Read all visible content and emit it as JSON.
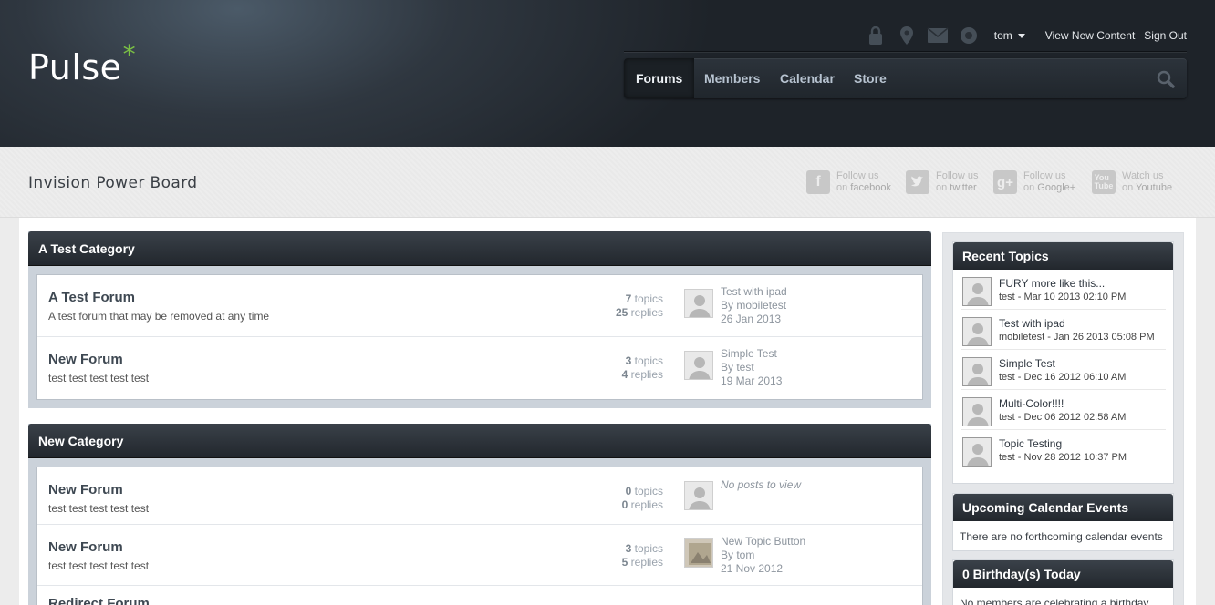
{
  "header": {
    "logo_text": "Pulse",
    "logo_mark": "*",
    "user": "tom",
    "view_new_content": "View New Content",
    "sign_out": "Sign Out"
  },
  "nav": {
    "tabs": [
      "Forums",
      "Members",
      "Calendar",
      "Store"
    ]
  },
  "board_title": "Invision Power Board",
  "social": [
    {
      "icon": "facebook-icon",
      "line1": "Follow us",
      "line2_prefix": "on ",
      "line2": "facebook"
    },
    {
      "icon": "twitter-icon",
      "line1": "Follow us",
      "line2_prefix": "on ",
      "line2": "twitter"
    },
    {
      "icon": "google-plus-icon",
      "line1": "Follow us",
      "line2_prefix": "on ",
      "line2": "Google+"
    },
    {
      "icon": "youtube-icon",
      "line1": "Watch us",
      "line2_prefix": "on ",
      "line2": "Youtube"
    }
  ],
  "categories": [
    {
      "title": "A Test Category",
      "forums": [
        {
          "name": "A Test Forum",
          "desc": "A test forum that may be removed at any time",
          "topics": "7",
          "replies": "25",
          "last_title": "Test with ipad",
          "last_by": "By mobiletest",
          "last_date": "26 Jan 2013"
        },
        {
          "name": "New Forum",
          "desc": "test test test test test",
          "topics": "3",
          "replies": "4",
          "last_title": "Simple Test",
          "last_by": "By test",
          "last_date": "19 Mar 2013"
        }
      ]
    },
    {
      "title": "New Category",
      "forums": [
        {
          "name": "New Forum",
          "desc": "test test test test test",
          "topics": "0",
          "replies": "0",
          "last_title": "No posts to view",
          "last_by": "",
          "last_date": ""
        },
        {
          "name": "New Forum",
          "desc": "test test test test test",
          "topics": "3",
          "replies": "5",
          "last_title": "New Topic Button",
          "last_by": "By tom",
          "last_date": "21 Nov 2012"
        },
        {
          "name": "Redirect Forum",
          "desc": "",
          "topics": "",
          "replies": "",
          "last_title": "",
          "last_by": "",
          "last_date": ""
        }
      ]
    }
  ],
  "labels": {
    "topics": " topics",
    "replies": " replies"
  },
  "sidebar": {
    "recent_title": "Recent Topics",
    "recent": [
      {
        "title": "FURY more like this...",
        "user": "test",
        "date": " - Mar 10 2013 02:10 PM"
      },
      {
        "title": "Test with ipad",
        "user": "mobiletest",
        "date": " - Jan 26 2013 05:08 PM"
      },
      {
        "title": "Simple Test",
        "user": "test",
        "date": " - Dec 16 2012 06:10 AM"
      },
      {
        "title": "Multi-Color!!!!",
        "user": "test",
        "date": " - Dec 06 2012 02:58 AM"
      },
      {
        "title": "Topic Testing",
        "user": "test",
        "date": " - Nov 28 2012 10:37 PM"
      }
    ],
    "events_title": "Upcoming Calendar Events",
    "events_text": "There are no forthcoming calendar events",
    "birthday_title": "0 Birthday(s) Today",
    "birthday_text": "No members are celebrating a birthday"
  },
  "colors": {
    "accent_star": "#7bc144",
    "header_dark": "#22272d"
  }
}
